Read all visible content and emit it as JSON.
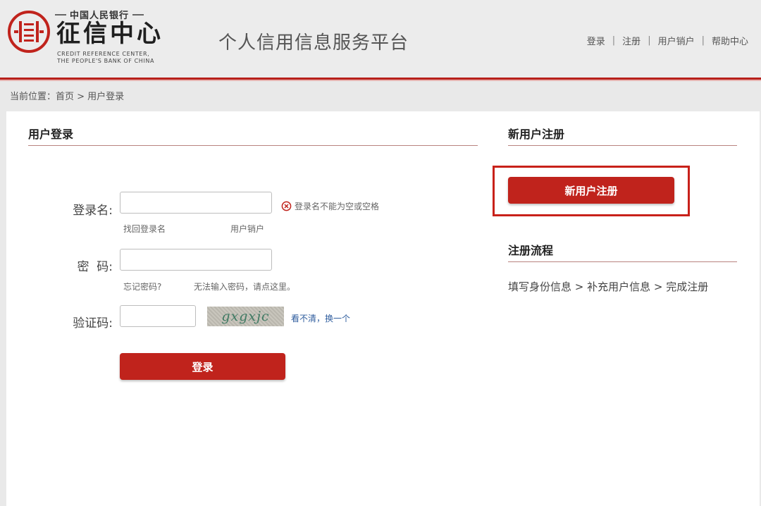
{
  "header": {
    "logo_top": "中国人民银行",
    "logo_main": "征信中心",
    "logo_en_line1": "CREDIT REFERENCE CENTER,",
    "logo_en_line2": "THE PEOPLE'S BANK OF CHINA",
    "site_title": "个人信用信息服务平台",
    "nav": [
      "登录",
      "注册",
      "用户销户",
      "帮助中心"
    ],
    "nav_separator": "|"
  },
  "breadcrumb": "当前位置：首页 > 用户登录",
  "login": {
    "title": "用户登录",
    "username_label": "登录名:",
    "username_value": "",
    "username_error": "登录名不能为空或空格",
    "find_username_link": "找回登录名",
    "cancel_account_link": "用户销户",
    "password_label": "密  码:",
    "password_value": "",
    "forgot_password_link": "忘记密码?",
    "cannot_input_password_link": "无法输入密码，请点这里。",
    "captcha_label": "验证码:",
    "captcha_value": "",
    "captcha_image_text": "gxgxjc",
    "captcha_refresh_link": "看不清，换一个",
    "submit_label": "登录"
  },
  "register": {
    "title": "新用户注册",
    "button_label": "新用户注册",
    "flow_title": "注册流程",
    "flow_steps": "填写身份信息 > 补充用户信息 > 完成注册"
  },
  "colors": {
    "brand_red": "#c0231c",
    "header_rule": "#b8201b",
    "section_rule": "#b9837f",
    "link_blue": "#2f5d9e"
  },
  "icons": {
    "logo": "credit-center-emblem-icon",
    "error": "error-circle-x-icon"
  }
}
